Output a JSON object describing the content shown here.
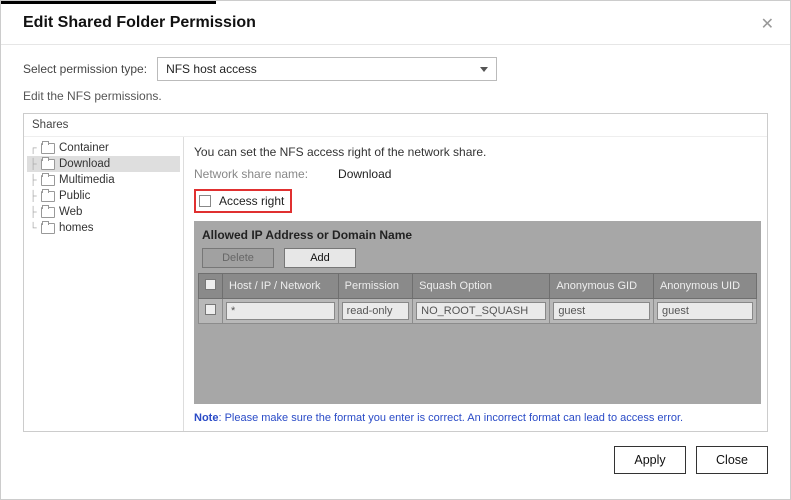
{
  "title": "Edit Shared Folder Permission",
  "select_label": "Select permission type:",
  "select_value": "NFS host access",
  "edit_note": "Edit the NFS permissions.",
  "shares_header": "Shares",
  "tree": {
    "items": [
      {
        "label": "Container",
        "selected": false
      },
      {
        "label": "Download",
        "selected": true
      },
      {
        "label": "Multimedia",
        "selected": false
      },
      {
        "label": "Public",
        "selected": false
      },
      {
        "label": "Web",
        "selected": false
      },
      {
        "label": "homes",
        "selected": false
      }
    ]
  },
  "detail": {
    "intro": "You can set the NFS access right of the network share.",
    "share_name_label": "Network share name:",
    "share_name_value": "Download",
    "access_right_label": "Access right",
    "allowed_title": "Allowed IP Address or Domain Name",
    "buttons": {
      "delete": "Delete",
      "add": "Add"
    },
    "columns": {
      "host": "Host / IP / Network",
      "permission": "Permission",
      "squash": "Squash Option",
      "anon_gid": "Anonymous GID",
      "anon_uid": "Anonymous UID"
    },
    "rows": [
      {
        "host": "*",
        "permission": "read-only",
        "squash": "NO_ROOT_SQUASH",
        "anon_gid": "guest",
        "anon_uid": "guest"
      }
    ],
    "note_label": "Note",
    "note_text": ": Please make sure the format you enter is correct. An incorrect format can lead to access error."
  },
  "footer": {
    "apply": "Apply",
    "close": "Close"
  }
}
